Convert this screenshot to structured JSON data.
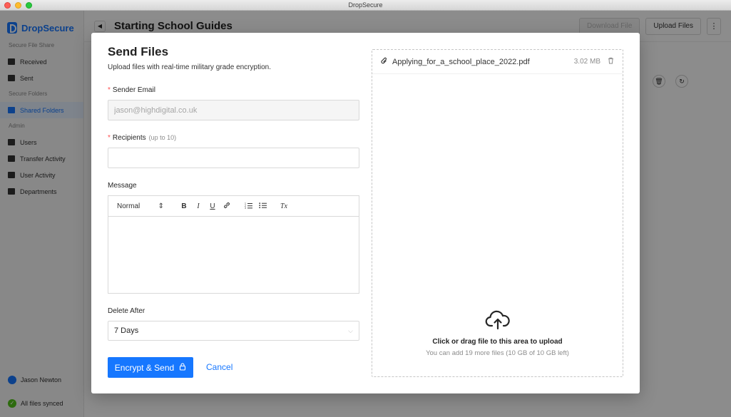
{
  "window": {
    "title": "DropSecure"
  },
  "sidebar": {
    "brand": "DropSecure",
    "sections": [
      {
        "label": "Secure File Share",
        "items": [
          {
            "label": "Received",
            "icon": "inbox-icon"
          },
          {
            "label": "Sent",
            "icon": "send-icon"
          }
        ]
      },
      {
        "label": "Secure Folders",
        "items": [
          {
            "label": "Shared Folders",
            "icon": "folder-icon",
            "active": true
          }
        ]
      },
      {
        "label": "Admin",
        "items": [
          {
            "label": "Users",
            "icon": "users-icon"
          },
          {
            "label": "Transfer Activity",
            "icon": "transfer-icon"
          },
          {
            "label": "User Activity",
            "icon": "activity-icon"
          },
          {
            "label": "Departments",
            "icon": "bank-icon"
          }
        ]
      }
    ],
    "user_name": "Jason Newton",
    "sync_status": "All files synced"
  },
  "main": {
    "title": "Starting School Guides",
    "download_label": "Download File",
    "upload_label": "Upload Files"
  },
  "modal": {
    "title": "Send Files",
    "subtitle": "Upload files with real-time military grade encryption.",
    "sender_label": "Sender Email",
    "sender_value": "jason@highdigital.co.uk",
    "recipients_label": "Recipients",
    "recipients_hint": "(up to 10)",
    "recipients_value": "",
    "message_label": "Message",
    "editor": {
      "format": "Normal",
      "bold": "B",
      "italic": "I",
      "underline": "U",
      "clear": "Tx"
    },
    "delete_after_label": "Delete After",
    "delete_after_value": "7 Days",
    "send_label": "Encrypt & Send",
    "cancel_label": "Cancel"
  },
  "upload": {
    "files": [
      {
        "name": "Applying_for_a_school_place_2022.pdf",
        "size": "3.02 MB"
      }
    ],
    "drop_text": "Click or drag file to this area to upload",
    "drop_hint": "You can add 19 more files (10 GB of 10 GB left)"
  },
  "colors": {
    "accent": "#1677ff",
    "required": "#ff4d4f",
    "success": "#52c41a"
  }
}
